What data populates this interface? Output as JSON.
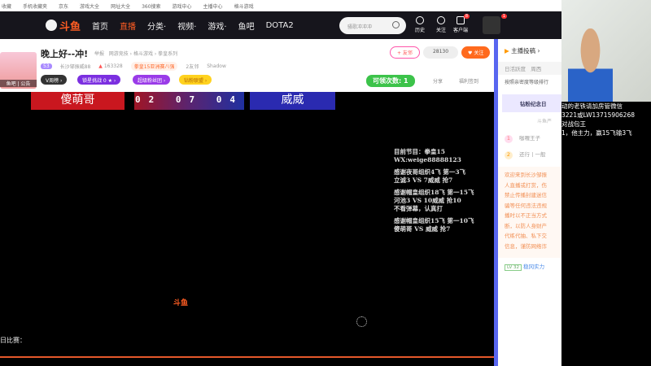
{
  "bookmarks": [
    "收藏",
    "手机收藏夹",
    "京东",
    "游戏大全",
    "网址大全",
    "360搜索",
    "游戏中心",
    "主播中心",
    "格斗游戏"
  ],
  "nav": {
    "logo": "斗鱼",
    "items": [
      "首页",
      "直播",
      "分类·",
      "视频·",
      "游戏·",
      "鱼吧",
      "DOTA2"
    ],
    "search_placeholder": "骚歌冲冲冲",
    "icons": [
      "历史",
      "关注",
      "客户端"
    ],
    "client_badge": "8",
    "avatar_badge": "1"
  },
  "room": {
    "title": "晚上好--冲!",
    "report": "举报",
    "crumbs": "网游竞技 › 格斗游戏 › 拳皇系列",
    "level": "53",
    "streamer": "长沙邹振威88",
    "heat": "163328",
    "tag": "拳皇15亚洲赛八强",
    "friends": "2友邻",
    "shadow": "Shadow",
    "avatar_label": "鱼吧 | 公告",
    "pills": [
      "V周榜 ›",
      "锁星挑战 0 ★ ›",
      "超级粉丝团 ›",
      "钻粉联盟 ›"
    ],
    "friend_btn": "+ 友邻",
    "follow_count": "28130",
    "follow_btn": "♥ 关注",
    "claim": "可领次数: 1",
    "share": "分享",
    "checkin": "福利签到"
  },
  "video": {
    "player_left": "傻萌哥",
    "score": "02 07 04",
    "player_right": "威威",
    "notes": [
      "目前节目：拳皇15",
      "WX:weige88888123",
      "感谢夜哥组织4飞 第一3飞",
      "立诚3 VS 7威威 抢7",
      "感谢帽皇组织18飞 第一15飞",
      "河池3 VS 10威威 抢10",
      "不看弹幕，认真打",
      "感谢帽皇组织15飞 第一10飞",
      "傻萌哥 VS 威威 抢7"
    ],
    "watermark": "斗鱼",
    "bottom_left": "日比赛："
  },
  "sidebar": {
    "header": "主播投稿 ›",
    "tabs": [
      "日活跃度",
      "周西"
    ],
    "sort": "按照亲密度等级排行",
    "anniv": "钻粉纪念日",
    "sub": "斗鱼严",
    "ranks": [
      {
        "n": "1",
        "name": "咖喱王子"
      },
      {
        "n": "2",
        "name": "还行丨一般"
      }
    ],
    "notice": [
      "欢迎来到长沙邹振",
      "人直播或打赏，伤",
      "禁止传播封建迷信",
      "骗等任何违法违规",
      "播时以不正当方式",
      "断，以防人身财产",
      "代练代抽、私下交",
      "信息，谨防网络诈"
    ],
    "lv": "LV 32",
    "user": "稳冈实力"
  },
  "camera": {
    "lines": [
      "动的老铁请加房管微信",
      "3221或LW13715906268",
      "对战包王",
      "1，他主力，赢15飞输3飞"
    ]
  }
}
